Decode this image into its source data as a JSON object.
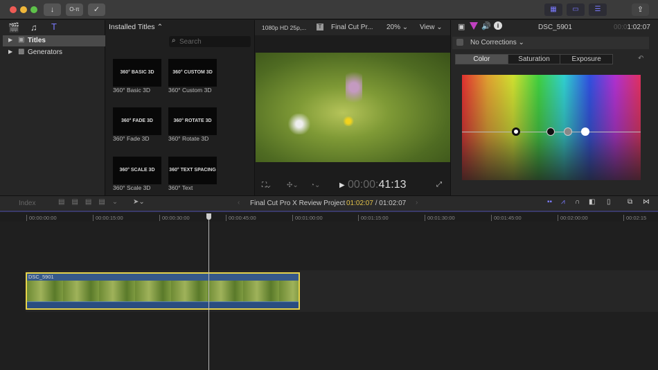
{
  "toolbar": {
    "import": "↓",
    "keywords": "O-π",
    "check": "✓",
    "share": "⇪"
  },
  "sidebar": {
    "items": [
      {
        "label": "Titles",
        "selected": true
      },
      {
        "label": "Generators",
        "selected": false
      }
    ]
  },
  "browser": {
    "title": "Installed Titles ⌃",
    "search_placeholder": "Search",
    "tiles": [
      {
        "thumb": "360° BASIC 3D",
        "label": "360° Basic 3D"
      },
      {
        "thumb": "360° CUSTOM 3D",
        "label": "360° Custom 3D"
      },
      {
        "thumb": "360° FADE 3D",
        "label": "360° Fade 3D"
      },
      {
        "thumb": "360° ROTATE 3D",
        "label": "360° Rotate 3D"
      },
      {
        "thumb": "360° SCALE 3D",
        "label": "360° Scale 3D"
      },
      {
        "thumb": "360° TEXT SPACING 3D",
        "label": "360° Text"
      }
    ]
  },
  "viewer": {
    "format": "1080p HD 25p,...",
    "project": "Final Cut Pr...",
    "zoom": "20% ⌄",
    "view": "View ⌄",
    "timecode_dim": "00:00:",
    "timecode": "41:13"
  },
  "inspector": {
    "clip": "DSC_5901",
    "duration_dim": "00:0",
    "duration": "1:02:07",
    "corrections": "No Corrections ⌄",
    "tabs": [
      "Color",
      "Saturation",
      "Exposure"
    ],
    "active_tab": "Color"
  },
  "timeline": {
    "index": "Index",
    "project": "Final Cut Pro X Review Project",
    "current": "01:02:07",
    "total": " / 01:02:07",
    "ticks": [
      "00:00:00:00",
      "00:00:15:00",
      "00:00:30:00",
      "00:00:45:00",
      "00:01:00:00",
      "00:01:15:00",
      "00:01:30:00",
      "00:01:45:00",
      "00:02:00:00",
      "00:02:15"
    ],
    "clip_name": "DSC_5901"
  },
  "colors": {
    "accent": "#7b7bff",
    "timecode": "#e3c34a",
    "clip_border": "#e8d44a"
  }
}
